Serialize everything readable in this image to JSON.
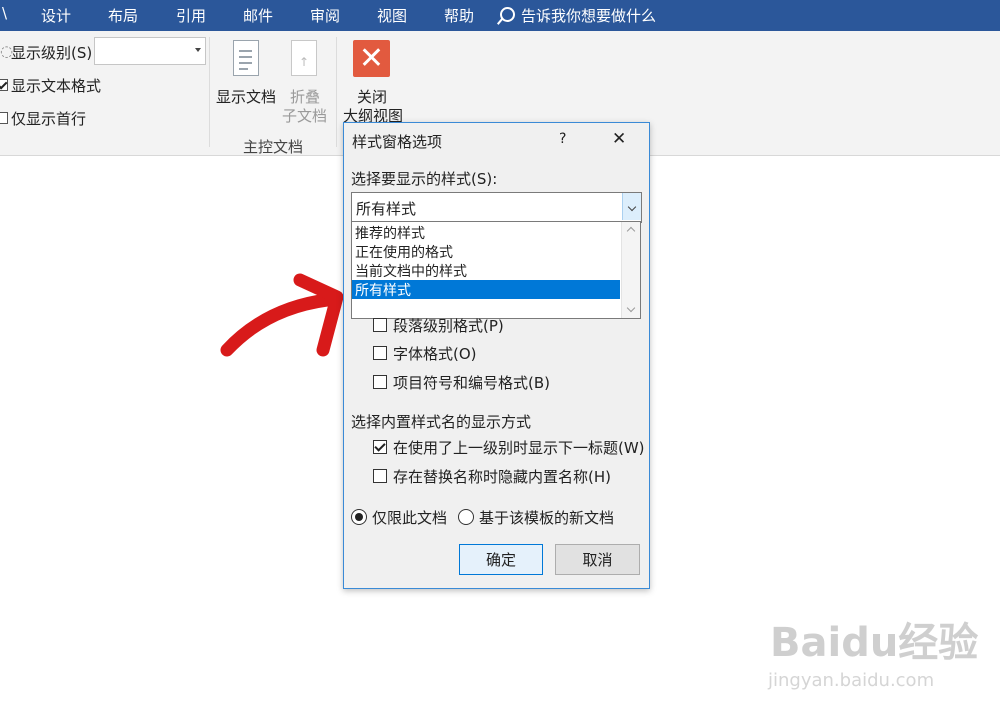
{
  "ribbon_tabs": [
    "设计",
    "布局",
    "引用",
    "邮件",
    "审阅",
    "视图",
    "帮助"
  ],
  "tell_me": "告诉我你想要做什么",
  "outline": {
    "show_level_label": "显示级别(S):",
    "show_text_format_label": "显示文本格式",
    "show_first_line_label": "仅显示首行",
    "show_text_format_checked": true,
    "show_first_line_checked": false
  },
  "master_doc": {
    "show_doc_label": "显示文档",
    "collapse_line1": "折叠",
    "collapse_line2": "子文档",
    "group_label": "主控文档"
  },
  "close_group": {
    "line1": "关闭",
    "line2": "大纲视图"
  },
  "dialog": {
    "title": "样式窗格选项",
    "help": "?",
    "close": "✕",
    "select_label": "选择要显示的样式(S):",
    "combo_value": "所有样式",
    "options": [
      "推荐的样式",
      "正在使用的格式",
      "当前文档中的样式",
      "所有样式"
    ],
    "selected_option": "所有样式",
    "format_checks": [
      {
        "label": "段落级别格式(P)",
        "checked": false
      },
      {
        "label": "字体格式(O)",
        "checked": false
      },
      {
        "label": "项目符号和编号格式(B)",
        "checked": false
      }
    ],
    "builtin_label": "选择内置样式名的显示方式",
    "builtin_checks": [
      {
        "label": "在使用了上一级别时显示下一标题(W)",
        "checked": true
      },
      {
        "label": "存在替换名称时隐藏内置名称(H)",
        "checked": false
      }
    ],
    "radio_this_doc": "仅限此文档",
    "radio_template": "基于该模板的新文档",
    "radio_selected": "仅限此文档",
    "ok": "确定",
    "cancel": "取消"
  },
  "watermark": {
    "main": "Baidu经验",
    "sub": "jingyan.baidu.com"
  },
  "colors": {
    "ribbon_blue": "#2b579a",
    "selection_blue": "#0078d7",
    "close_red": "#e25a3f",
    "arrow_red": "#d81a1a"
  }
}
